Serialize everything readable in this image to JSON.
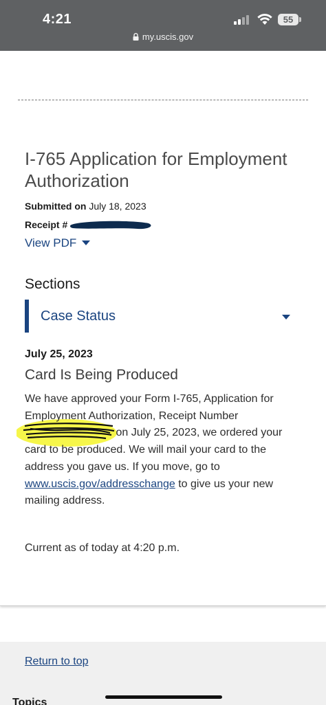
{
  "status_bar": {
    "time": "4:21",
    "battery": "55",
    "url": "my.uscis.gov"
  },
  "case": {
    "title": "I-765 Application for Employment Authorization",
    "submitted_label": "Submitted on",
    "submitted_date": "July 18, 2023",
    "receipt_label": "Receipt #",
    "view_pdf": "View PDF"
  },
  "sections": {
    "heading": "Sections",
    "accordion_label": "Case Status"
  },
  "status": {
    "date": "July 25, 2023",
    "title": "Card Is Being Produced",
    "text_1": "We have approved your Form I-765, Application for Employment Authorization, Receipt Number",
    "text_2": "on July 25, 2023, we ordered your card to be produced. We will mail your card to the address you gave us. If you move, go to",
    "link": "www.uscis.gov/addresschange",
    "text_3": "to give us your new mailing address."
  },
  "current_as_of": "Current as of today at 4:20 p.m.",
  "footer": {
    "return_to_top": "Return to top",
    "topics": "Topics"
  },
  "colors": {
    "link": "#1a4480",
    "status_bar": "#5f6163",
    "highlight": "#f5f52a"
  }
}
